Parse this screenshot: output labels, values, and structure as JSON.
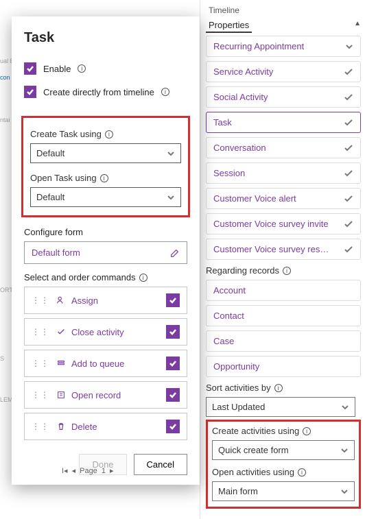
{
  "right": {
    "timeline": "Timeline",
    "properties": "Properties",
    "activity_types": [
      {
        "label": "Recurring Appointment",
        "selected": false
      },
      {
        "label": "Service Activity",
        "selected": false
      },
      {
        "label": "Social Activity",
        "selected": false
      },
      {
        "label": "Task",
        "selected": true
      },
      {
        "label": "Conversation",
        "selected": false
      },
      {
        "label": "Session",
        "selected": false
      },
      {
        "label": "Customer Voice alert",
        "selected": false
      },
      {
        "label": "Customer Voice survey invite",
        "selected": false
      },
      {
        "label": "Customer Voice survey response",
        "selected": false
      }
    ],
    "regarding_label": "Regarding records",
    "regarding": [
      "Account",
      "Contact",
      "Case",
      "Opportunity"
    ],
    "sort_label": "Sort activities by",
    "sort_value": "Last Updated",
    "create_label": "Create activities using",
    "create_value": "Quick create form",
    "open_label": "Open activities using",
    "open_value": "Main form"
  },
  "panel": {
    "title": "Task",
    "enable": "Enable",
    "create_directly": "Create directly from timeline",
    "create_task_label": "Create Task using",
    "create_task_value": "Default",
    "open_task_label": "Open Task using",
    "open_task_value": "Default",
    "configure_form": "Configure form",
    "default_form": "Default form",
    "commands_label": "Select and order commands",
    "commands": [
      {
        "name": "Assign",
        "icon": "user"
      },
      {
        "name": "Close activity",
        "icon": "check"
      },
      {
        "name": "Add to queue",
        "icon": "queue"
      },
      {
        "name": "Open record",
        "icon": "open"
      },
      {
        "name": "Delete",
        "icon": "trash"
      }
    ],
    "done": "Done",
    "cancel": "Cancel"
  },
  "pager": {
    "page_label": "Page",
    "page": "1"
  }
}
